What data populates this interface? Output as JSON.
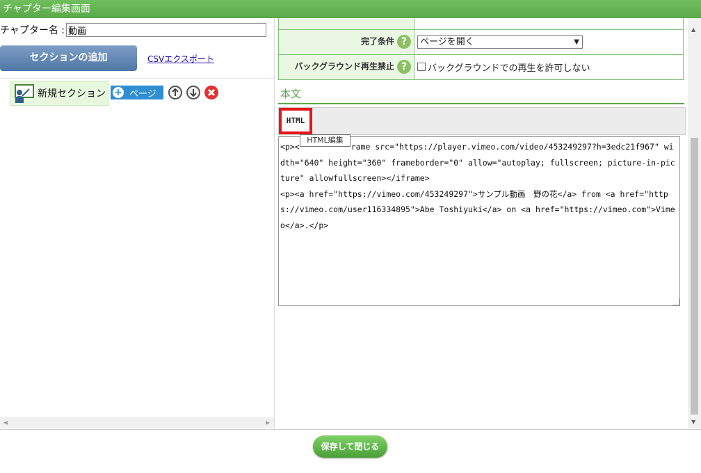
{
  "window": {
    "title": "チャプター編集画面"
  },
  "left": {
    "chapter_label": "チャプター名 :",
    "chapter_value": "動画",
    "add_section_label": "セクションの追加",
    "csv_export_label": "CSVエクスポート",
    "section": {
      "label": "新規セクション",
      "page_button": "ページ"
    }
  },
  "props": {
    "completion_label": "完了条件",
    "completion_value": "ページを開く",
    "background_label": "バックグラウンド再生禁止",
    "background_checkbox_label": "バックグラウンドでの再生を許可しない"
  },
  "body": {
    "heading": "本文",
    "html_button": "HTML",
    "tooltip": "HTML編集",
    "editor_before": "<p><",
    "editor_after": "rame src=\"https://player.vimeo.com/video/453249297?h=3edc21f967\" width=\"640\" height=\"360\" frameborder=\"0\" allow=\"autoplay; fullscreen; picture-in-picture\" allowfullscreen></iframe>\n<p><a href=\"https://vimeo.com/453249297\">サンプル動画　野の花</a> from <a href=\"https://vimeo.com/user116334895\">Abe Toshiyuki</a> on <a href=\"https://vimeo.com\">Vimeo</a>.</p>"
  },
  "footer": {
    "save_close_label": "保存して閉じる"
  },
  "colors": {
    "accent": "#5aa948",
    "highlight": "#e8151b",
    "section_bg": "#e8f8df",
    "button_blue": "#2e8fd3"
  }
}
